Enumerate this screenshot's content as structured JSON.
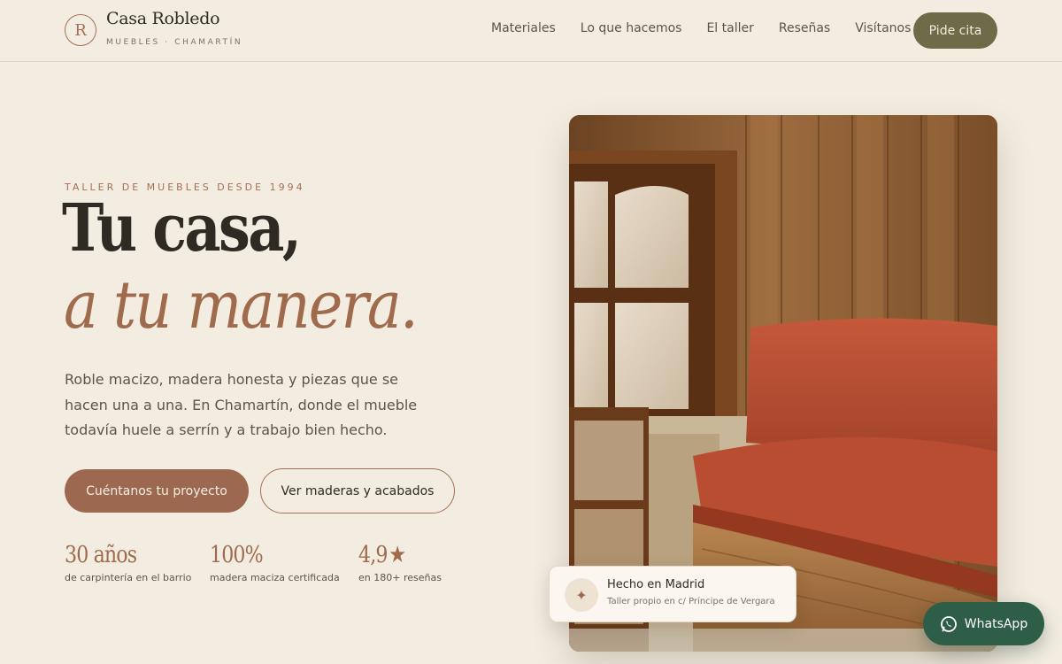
{
  "header": {
    "logo_letter": "R",
    "brand_name": "Casa Robledo",
    "brand_sub": "MUEBLES · CHAMARTÍN",
    "nav": [
      "Materiales",
      "Lo que hacemos",
      "El taller",
      "Reseñas",
      "Visítanos"
    ],
    "cta": "Pide cita"
  },
  "hero": {
    "eyebrow": "TALLER DE MUEBLES DESDE 1994",
    "headline_line1": "Tu casa,",
    "headline_line2": "a tu manera.",
    "lede": "Roble macizo, madera honesta y piezas que se hacen una a una. En Chamartín, donde el mueble todavía huele a serrín y a trabajo bien hecho.",
    "primary_button": "Cuéntanos tu proyecto",
    "secondary_button": "Ver maderas y acabados",
    "stats": [
      {
        "value": "30 años",
        "label": "de carpintería en el barrio"
      },
      {
        "value": "100%",
        "label": "madera maciza certificada"
      },
      {
        "value": "4,9",
        "label": "en 180+ reseñas"
      }
    ]
  },
  "badge": {
    "icon": "sparkle-icon",
    "title": "Hecho en Madrid",
    "subtitle": "Taller propio en c/ Príncipe de Vergara"
  },
  "whatsapp": {
    "icon": "whatsapp-icon",
    "label": "WhatsApp"
  },
  "colors": {
    "background": "#f3ede1",
    "accent_terracotta": "#9c6850",
    "olive_button": "#6f6b48",
    "whatsapp_green": "#2f5e48"
  }
}
